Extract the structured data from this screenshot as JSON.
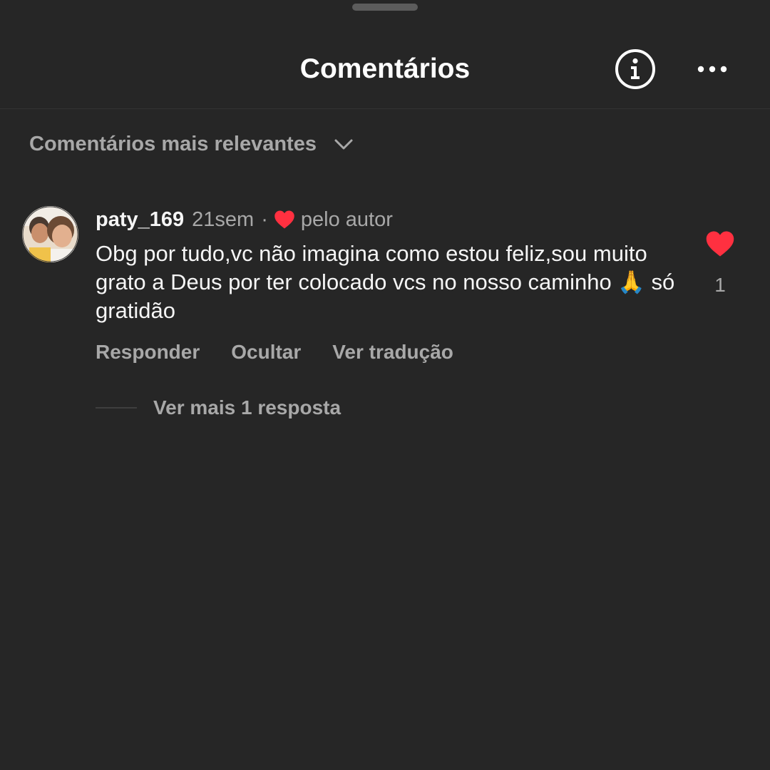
{
  "header": {
    "title": "Comentários",
    "info_icon": "info-circle-icon",
    "more_icon": "more-horizontal-icon"
  },
  "sort": {
    "label": "Comentários mais relevantes",
    "icon": "chevron-down-icon"
  },
  "comment": {
    "username": "paty_169",
    "time": "21sem",
    "separator": "·",
    "author_like_label": "pelo autor",
    "text": "Obg por tudo,vc não imagina como estou feliz,sou muito grato a Deus por ter colocado vcs no nosso caminho 🙏 só gratidão",
    "like_count": "1",
    "actions": {
      "reply": "Responder",
      "hide": "Ocultar",
      "translate": "Ver tradução"
    },
    "replies_label": "Ver mais 1 resposta"
  },
  "colors": {
    "background": "#262626",
    "text_primary": "#f5f5f5",
    "text_secondary": "#a8a8a8",
    "like": "#ff3040"
  }
}
